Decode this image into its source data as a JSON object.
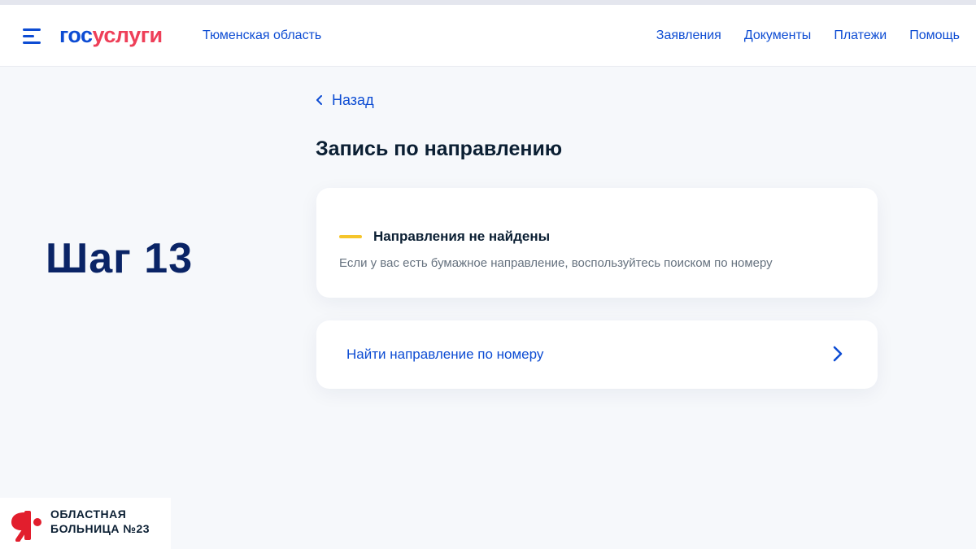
{
  "header": {
    "logo_part1": "гос",
    "logo_part2": "услуги",
    "region": "Тюменская область",
    "nav": [
      "Заявления",
      "Документы",
      "Платежи",
      "Помощь"
    ]
  },
  "overlay": {
    "step": "Шаг 13"
  },
  "main": {
    "back_label": "Назад",
    "title": "Запись по направлению",
    "notice_title": "Направления не найдены",
    "notice_text": "Если у вас есть бумажное направление, воспользуйтесь поиском по номеру",
    "search_link": "Найти направление по номеру"
  },
  "badge": {
    "line1": "ОБЛАСТНАЯ",
    "line2": "БОЛЬНИЦА №23"
  },
  "icons": {
    "menu": "hamburger-menu-icon",
    "back": "chevron-left-icon",
    "warning": "warning-bar-icon",
    "forward": "chevron-right-icon",
    "hospital_logo": "hospital-logo-icon"
  },
  "colors": {
    "accent": "#0d4cd3",
    "logo_red": "#ee3f58",
    "warning": "#f5c52b",
    "step_text": "#0a2466",
    "hospital_red": "#e21e2d"
  }
}
